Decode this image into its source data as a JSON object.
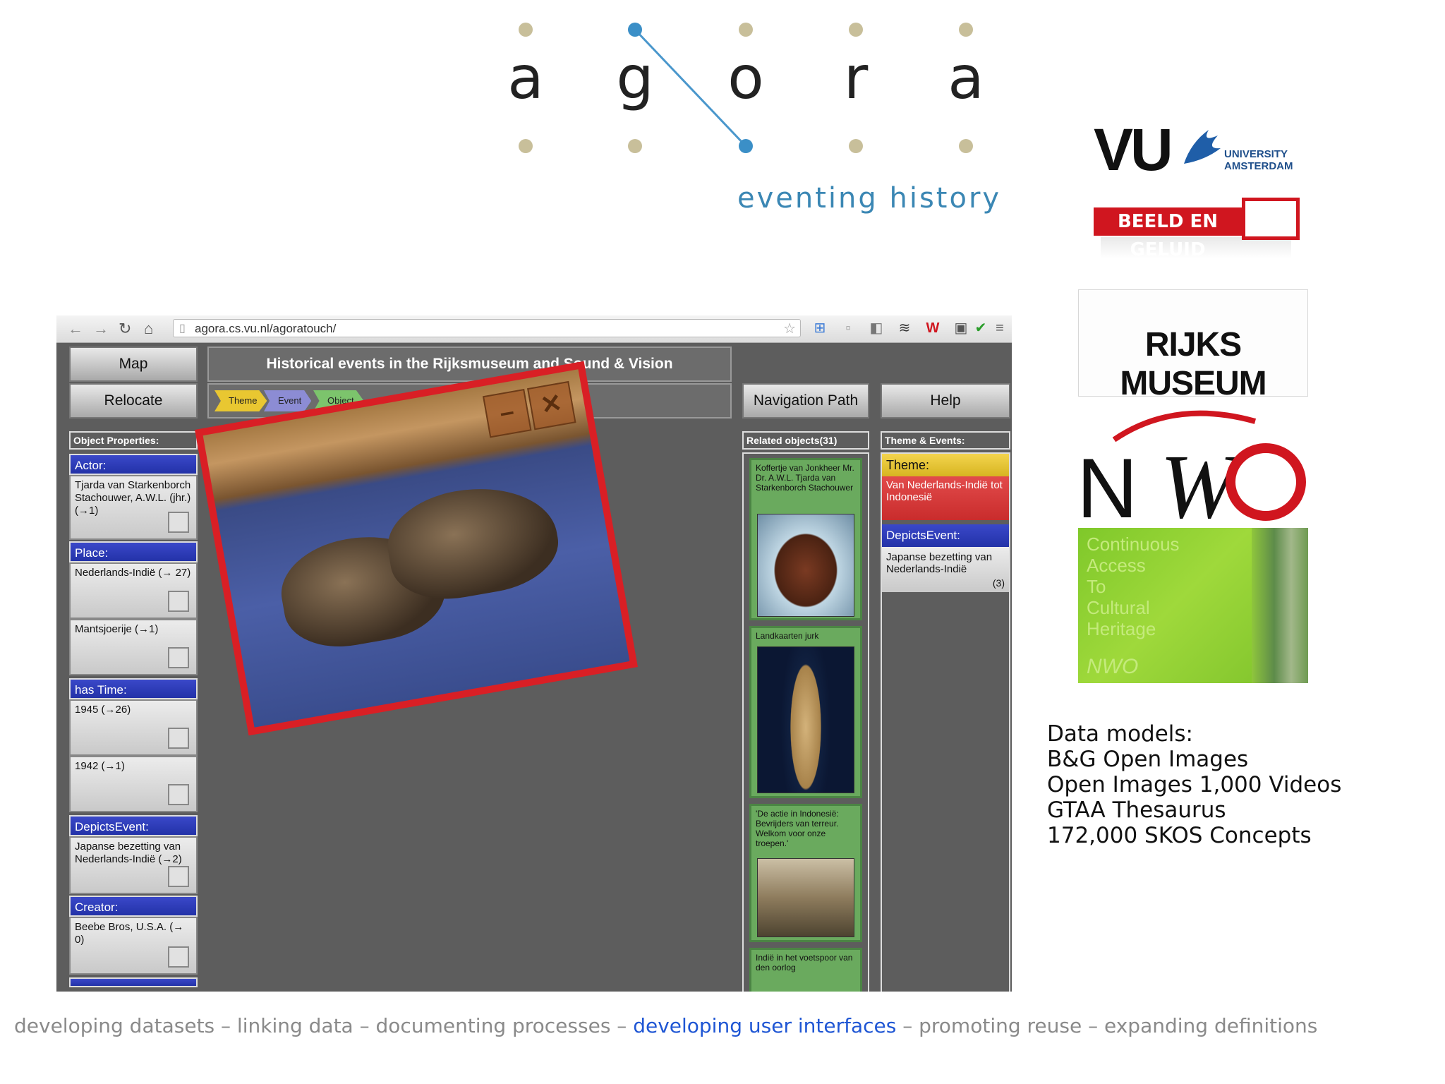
{
  "agora": {
    "letters": [
      "a",
      "g",
      "o",
      "r",
      "a"
    ],
    "tagline": "eventing history"
  },
  "logos": {
    "vu": {
      "text": "VU",
      "sub_line1": "UNIVERSITY",
      "sub_line2": "AMSTERDAM"
    },
    "beeld": {
      "text": "BEELD EN GELUID"
    },
    "rijks": {
      "text": "RIJKS MUSEUM"
    },
    "nwo": {
      "text": "NWO"
    },
    "catch": {
      "lines": [
        "Continuous",
        "Access",
        "To",
        "Cultural",
        "Heritage"
      ],
      "brand": "NWO"
    }
  },
  "data_models": {
    "lines": [
      "Data models:",
      "B&G Open Images",
      "Open Images 1,000 Videos",
      "GTAA Thesaurus",
      "172,000 SKOS Concepts"
    ]
  },
  "footer": {
    "part1": "developing datasets – linking data – documenting processes – ",
    "highlight": "developing user interfaces",
    "part2": " – promoting reuse – expanding definitions"
  },
  "browser": {
    "url": "agora.cs.vu.nl/agoratouch/",
    "icons": [
      "back-icon",
      "forward-icon",
      "reload-icon",
      "home-icon",
      "star-icon",
      "menu-icon"
    ]
  },
  "app": {
    "map_button": "Map",
    "relocate_button": "Relocate",
    "title": "Historical events in the Rijksmuseum and Sound & Vision",
    "nav_path_button": "Navigation Path",
    "help_button": "Help",
    "breadcrumbs": [
      "Theme",
      "Event",
      "Object"
    ],
    "object_properties_label": "Object Properties:",
    "related_label": "Related objects(31)",
    "theme_events_label": "Theme & Events:",
    "properties": {
      "actor_label": "Actor:",
      "actor_value": "Tjarda van Starkenborch Stachouwer, A.W.L. (jhr.) (→1)",
      "place_label": "Place:",
      "place_value_1": "Nederlands-Indië (→ 27)",
      "place_value_2": "Mantsjoerije (→1)",
      "time_label": "has Time:",
      "time_value_1": "1945 (→26)",
      "time_value_2": "1942 (→1)",
      "event_label": "DepictsEvent:",
      "event_value": "Japanse bezetting van Nederlands-Indië (→2)",
      "creator_label": "Creator:",
      "creator_value": "Beebe Bros, U.S.A. (→ 0)"
    },
    "related": [
      {
        "title": "Koffertje van Jonkheer Mr. Dr. A.W.L. Tjarda van Starkenborch Stachouwer"
      },
      {
        "title": "Landkaarten jurk"
      },
      {
        "title": "'De actie in Indonesië: Bevrijders van terreur. Welkom voor onze troepen.'"
      },
      {
        "title": "Indië in het voetspoor van den oorlog"
      }
    ],
    "theme": {
      "theme_label": "Theme:",
      "theme_value": "Van Nederlands-Indië tot Indonesië",
      "event_label": "DepictsEvent:",
      "event_value": "Japanse bezetting van Nederlands-Indië",
      "event_count": "(3)"
    }
  },
  "colors": {
    "accent_blue": "#2332a8",
    "photo_frame": "#d91f25",
    "theme_yellow": "#f3d44e",
    "theme_red": "#e24b4b",
    "related_green": "#6aaa5e"
  }
}
